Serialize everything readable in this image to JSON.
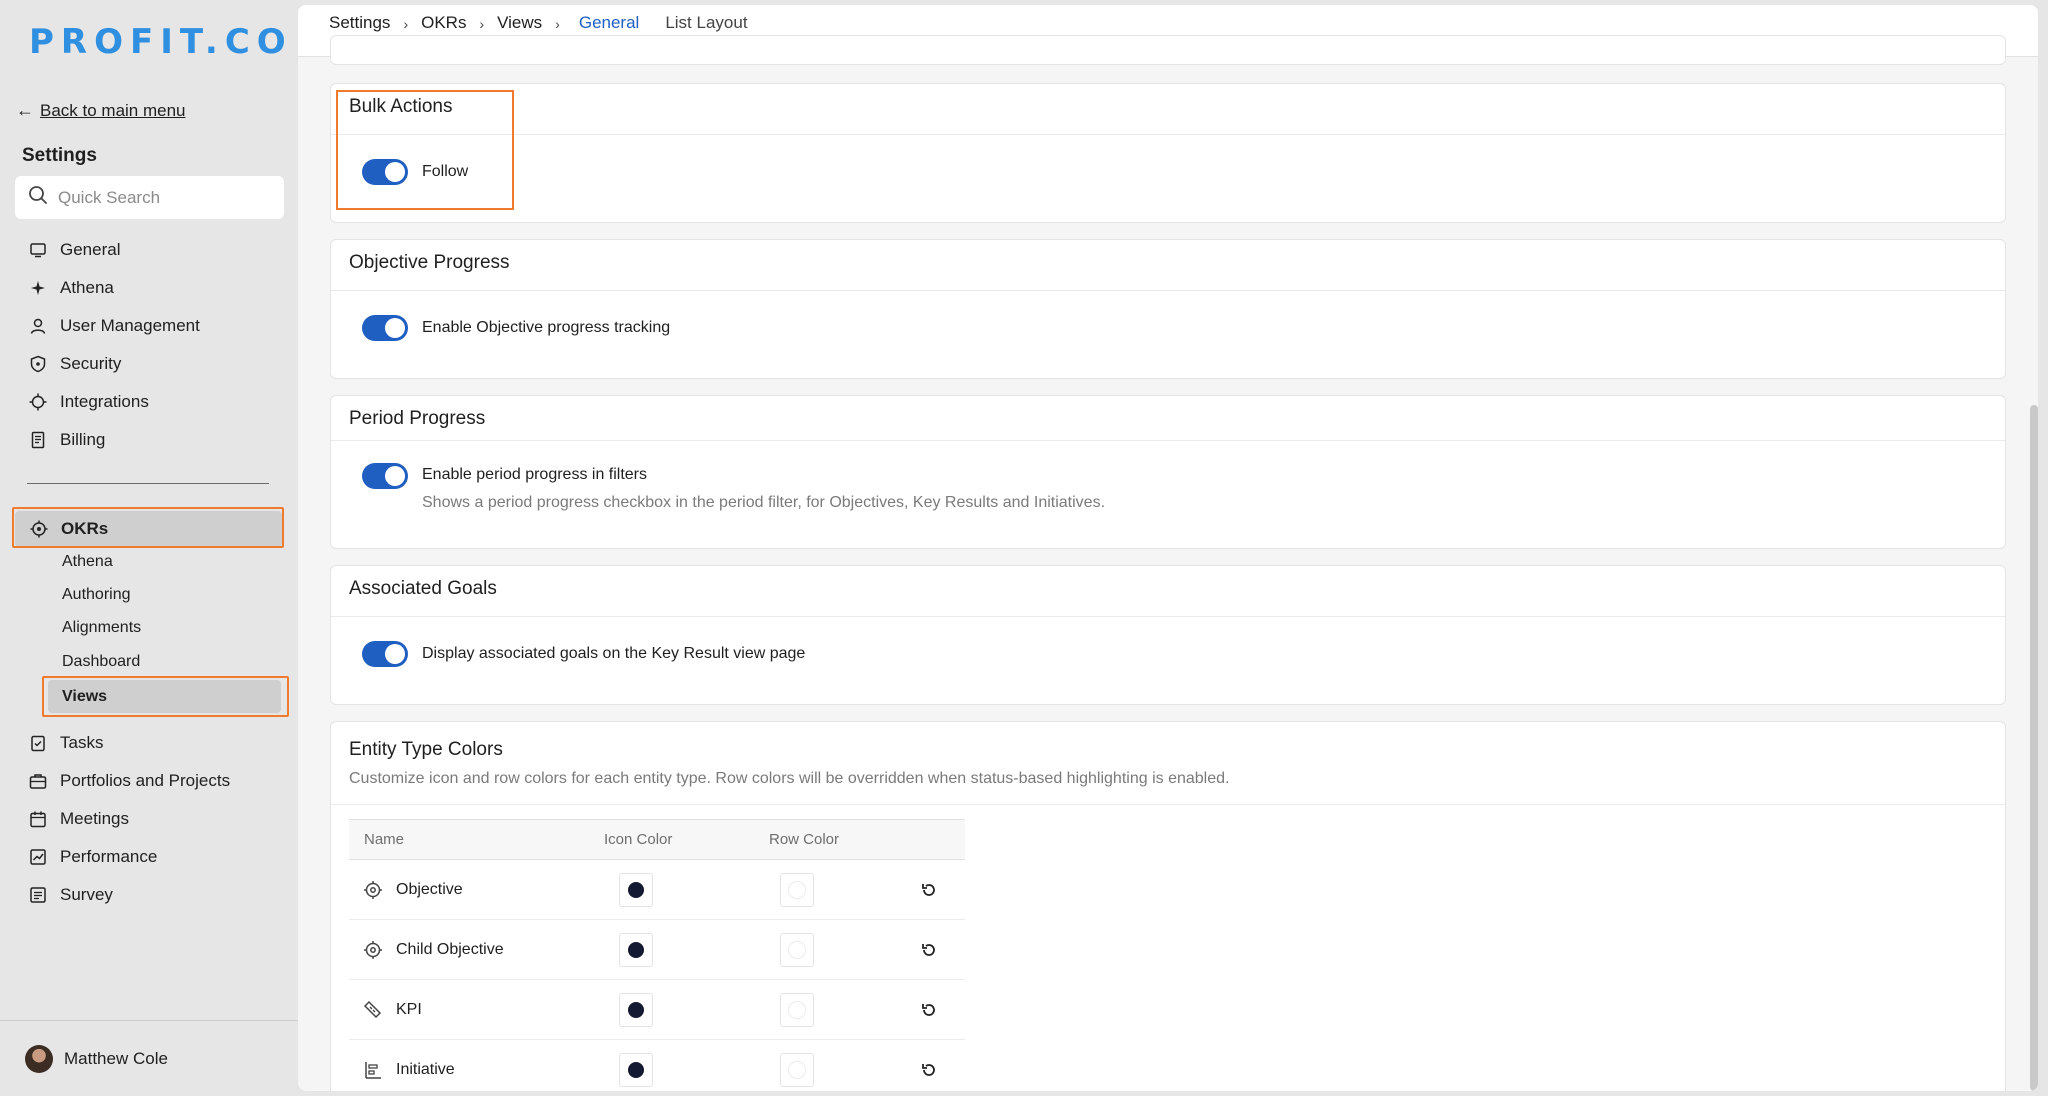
{
  "brand": {
    "logo_text": "PROFIT.CO",
    "accent": "#2f8fe0"
  },
  "sidebar": {
    "back_label": "Back to main menu",
    "title": "Settings",
    "search_placeholder": "Quick Search",
    "items": [
      {
        "label": "General",
        "icon": "monitor-icon"
      },
      {
        "label": "Athena",
        "icon": "sparkle-icon"
      },
      {
        "label": "User Management",
        "icon": "user-icon"
      },
      {
        "label": "Security",
        "icon": "shield-icon"
      },
      {
        "label": "Integrations",
        "icon": "integrations-icon"
      },
      {
        "label": "Billing",
        "icon": "receipt-icon"
      }
    ],
    "okrs": {
      "label": "OKRs",
      "icon": "target-icon",
      "children": [
        "Athena",
        "Authoring",
        "Alignments",
        "Dashboard",
        "Views"
      ]
    },
    "items_after": [
      {
        "label": "Tasks",
        "icon": "clipboard-check-icon"
      },
      {
        "label": "Portfolios and Projects",
        "icon": "briefcase-icon"
      },
      {
        "label": "Meetings",
        "icon": "calendar-icon"
      },
      {
        "label": "Performance",
        "icon": "chart-icon"
      },
      {
        "label": "Survey",
        "icon": "list-icon"
      }
    ],
    "user": {
      "name": "Matthew Cole"
    }
  },
  "breadcrumb": {
    "items": [
      "Settings",
      "OKRs",
      "Views"
    ],
    "tabs": {
      "active": "General",
      "other": "List Layout"
    }
  },
  "sections": {
    "bulk_actions": {
      "title": "Bulk Actions",
      "toggle_label": "Follow",
      "enabled": true
    },
    "objective_progress": {
      "title": "Objective Progress",
      "toggle_label": "Enable Objective progress tracking",
      "enabled": true
    },
    "period_progress": {
      "title": "Period Progress",
      "toggle_label": "Enable period progress in filters",
      "description": "Shows a period progress checkbox in the period filter, for Objectives, Key Results and Initiatives.",
      "enabled": true
    },
    "associated_goals": {
      "title": "Associated Goals",
      "toggle_label": "Display associated goals on the Key Result view page",
      "enabled": true
    },
    "entity_colors": {
      "title": "Entity Type Colors",
      "description": "Customize icon and row colors for each entity type. Row colors will be overridden when status-based highlighting is enabled.",
      "columns": [
        "Name",
        "Icon Color",
        "Row Color"
      ],
      "rows": [
        {
          "name": "Objective",
          "icon": "target-icon",
          "icon_color": "#151a33",
          "row_color": "#ffffff"
        },
        {
          "name": "Child Objective",
          "icon": "target-icon",
          "icon_color": "#151a33",
          "row_color": "#ffffff"
        },
        {
          "name": "KPI",
          "icon": "tag-icon",
          "icon_color": "#151a33",
          "row_color": "#ffffff"
        },
        {
          "name": "Initiative",
          "icon": "initiative-icon",
          "icon_color": "#151a33",
          "row_color": "#ffffff"
        }
      ]
    }
  },
  "colors": {
    "toggle_on": "#1f5fc2",
    "highlight": "#f07a2e"
  }
}
